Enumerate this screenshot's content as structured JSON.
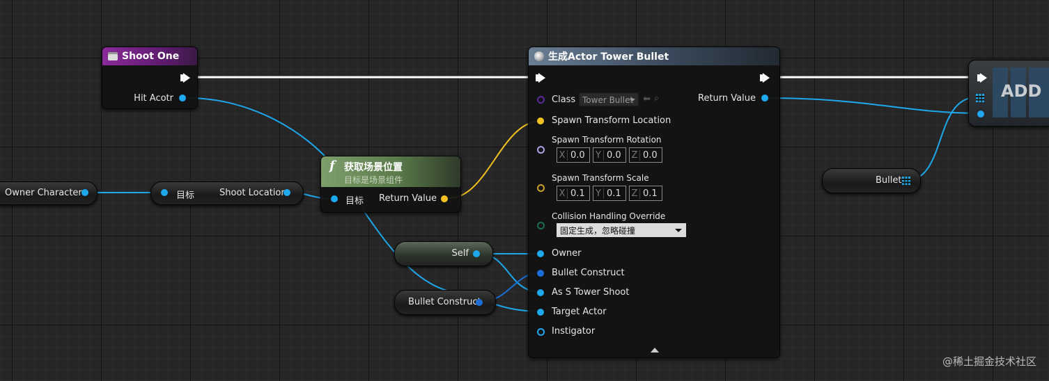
{
  "nodes": {
    "shoot_one": {
      "title": "Shoot One",
      "pin_hit_actor": "Hit Acotr"
    },
    "spawn_actor": {
      "title": "生成Actor Tower Bullet",
      "class_label": "Class",
      "class_value": "Tower Bullet",
      "return_value": "Return Value",
      "spawn_location": "Spawn Transform Location",
      "spawn_rotation": "Spawn Transform Rotation",
      "rotation": {
        "x": "0.0",
        "y": "0.0",
        "z": "0.0"
      },
      "spawn_scale": "Spawn Transform Scale",
      "scale": {
        "x": "0.1",
        "y": "0.1",
        "z": "0.1"
      },
      "collision_label": "Collision Handling Override",
      "collision_value": "固定生成，忽略碰撞",
      "owner": "Owner",
      "bullet_construct": "Bullet Construct",
      "as_s_tower_shoot": "As S Tower Shoot",
      "target_actor": "Target Actor",
      "instigator": "Instigator"
    },
    "get_location": {
      "title": "获取场景位置",
      "subtitle": "目标是场景组件",
      "target": "目标",
      "return_value": "Return Value"
    },
    "shoot_location_var": {
      "target": "目标",
      "label": "Shoot Location"
    },
    "owner_character": {
      "label": "Owner Character"
    },
    "self": {
      "label": "Self"
    },
    "bullet_construct_var": {
      "label": "Bullet Construct"
    },
    "bullet_var": {
      "label": "Bullet"
    },
    "add": {
      "label": "ADD"
    }
  },
  "axis_labels": {
    "x": "X",
    "y": "Y",
    "z": "Z"
  },
  "watermark": "@稀土掘金技术社区",
  "colors": {
    "exec": "#ffffff",
    "object_pin": "#1ea8ee",
    "vector_pin": "#f2c021",
    "event_header": "#7a2a8e",
    "function_header": "#5b7a4a",
    "spawn_header": "#3a4a5c"
  },
  "icons": [
    "event-icon",
    "function-icon",
    "spawn-icon",
    "array-grid-icon",
    "back-arrow-icon",
    "browse-icon",
    "expand-arrow-icon"
  ]
}
